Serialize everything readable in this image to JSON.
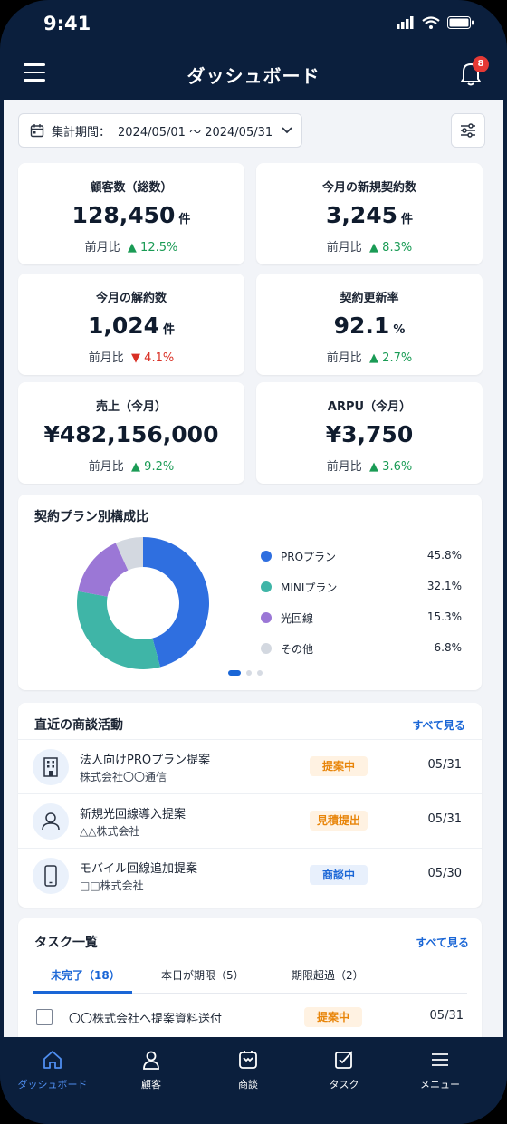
{
  "status_bar": {
    "time": "9:41"
  },
  "app_bar": {
    "title": "ダッシュボード",
    "notification_count": "8"
  },
  "filter": {
    "label": "集計期間：",
    "range": "2024/05/01 〜 2024/05/31"
  },
  "kpis": [
    {
      "title": "顧客数（総数）",
      "value": "128,450",
      "unit": "件",
      "compare_label": "前月比",
      "change": "▲ 12.5%",
      "direction": "up"
    },
    {
      "title": "今月の新規契約数",
      "value": "3,245",
      "unit": "件",
      "compare_label": "前月比",
      "change": "▲ 8.3%",
      "direction": "up"
    },
    {
      "title": "今月の解約数",
      "value": "1,024",
      "unit": "件",
      "compare_label": "前月比",
      "change": "▼ 4.1%",
      "direction": "down"
    },
    {
      "title": "契約更新率",
      "value": "92.1",
      "unit": "%",
      "compare_label": "前月比",
      "change": "▲ 2.7%",
      "direction": "up"
    },
    {
      "title": "売上（今月）",
      "value": "¥482,156,000",
      "unit": "",
      "compare_label": "前月比",
      "change": "▲ 9.2%",
      "direction": "up"
    },
    {
      "title": "ARPU（今月）",
      "value": "¥3,750",
      "unit": "",
      "compare_label": "前月比",
      "change": "▲ 3.6%",
      "direction": "up"
    }
  ],
  "plan_chart": {
    "title": "契約プラン別構成比",
    "items": [
      {
        "name": "PROプラン",
        "pct_label": "45.8%",
        "color": "#2f6fe0"
      },
      {
        "name": "MINIプラン",
        "pct_label": "32.1%",
        "color": "#3fb5a7"
      },
      {
        "name": "光回線",
        "pct_label": "15.3%",
        "color": "#9b77d6"
      },
      {
        "name": "その他",
        "pct_label": "6.8%",
        "color": "#d3d8e0"
      }
    ]
  },
  "chart_data": {
    "type": "pie",
    "title": "契約プラン別構成比",
    "categories": [
      "PROプラン",
      "MINIプラン",
      "光回線",
      "その他"
    ],
    "values": [
      45.8,
      32.1,
      15.3,
      6.8
    ],
    "legend": "right"
  },
  "deals": {
    "title": "直近の商談活動",
    "see_all": "すべて見る",
    "items": [
      {
        "title": "法人向けPROプラン提案",
        "company": "株式会社〇〇通信",
        "status": "提案中",
        "status_color": "orange",
        "date": "05/31",
        "icon": "building-icon"
      },
      {
        "title": "新規光回線導入提案",
        "company": "△△株式会社",
        "status": "見積提出",
        "status_color": "orange",
        "date": "05/31",
        "icon": "person-icon"
      },
      {
        "title": "モバイル回線追加提案",
        "company": "□□株式会社",
        "status": "商談中",
        "status_color": "blue",
        "date": "05/30",
        "icon": "mobile-icon"
      }
    ]
  },
  "tasks": {
    "title": "タスク一覧",
    "see_all": "すべて見る",
    "tabs": [
      "未完了（18）",
      "本日が期限（5）",
      "期限超過（2）"
    ],
    "items": [
      {
        "text": "〇〇株式会社へ提案資料送付",
        "status": "提案中",
        "date": "05/31"
      }
    ]
  },
  "tab_bar": {
    "items": [
      {
        "label": "ダッシュボード",
        "icon": "home-icon",
        "active": true
      },
      {
        "label": "顧客",
        "icon": "user-icon",
        "active": false
      },
      {
        "label": "商談",
        "icon": "handshake-icon",
        "active": false
      },
      {
        "label": "タスク",
        "icon": "task-icon",
        "active": false
      },
      {
        "label": "メニュー",
        "icon": "menu-icon",
        "active": false
      }
    ]
  }
}
